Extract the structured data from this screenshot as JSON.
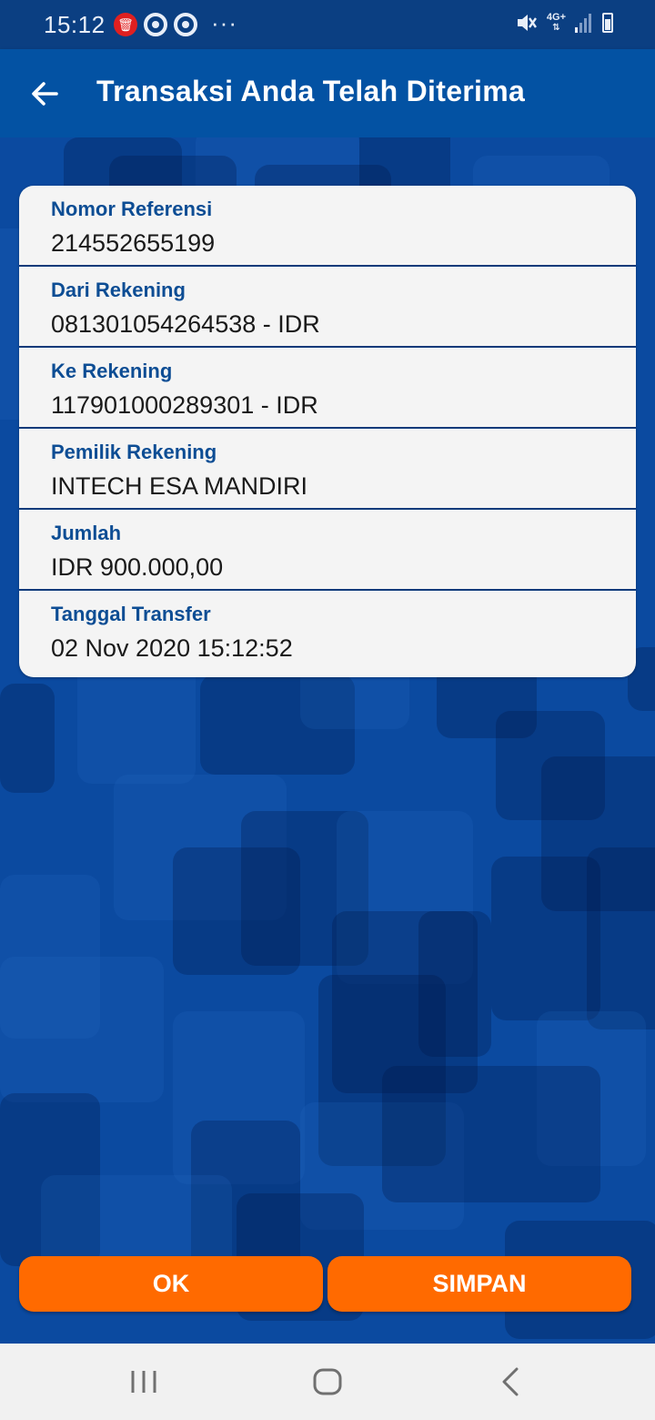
{
  "status_bar": {
    "time": "15:12",
    "dots": "···",
    "network": "4G+"
  },
  "header": {
    "title": "Transaksi Anda Telah Diterima"
  },
  "details": [
    {
      "label": "Nomor Referensi",
      "value": "214552655199"
    },
    {
      "label": "Dari Rekening",
      "value": "081301054264538 - IDR"
    },
    {
      "label": "Ke Rekening",
      "value": "117901000289301 - IDR"
    },
    {
      "label": "Pemilik Rekening",
      "value": "INTECH ESA MANDIRI"
    },
    {
      "label": "Jumlah",
      "value": "IDR 900.000,00"
    },
    {
      "label": "Tanggal Transfer",
      "value": "02 Nov 2020 15:12:52"
    }
  ],
  "actions": {
    "ok_label": "OK",
    "save_label": "SIMPAN"
  },
  "colors": {
    "primary": "#0352a3",
    "accent": "#ff6a00",
    "label": "#0d4d94"
  }
}
